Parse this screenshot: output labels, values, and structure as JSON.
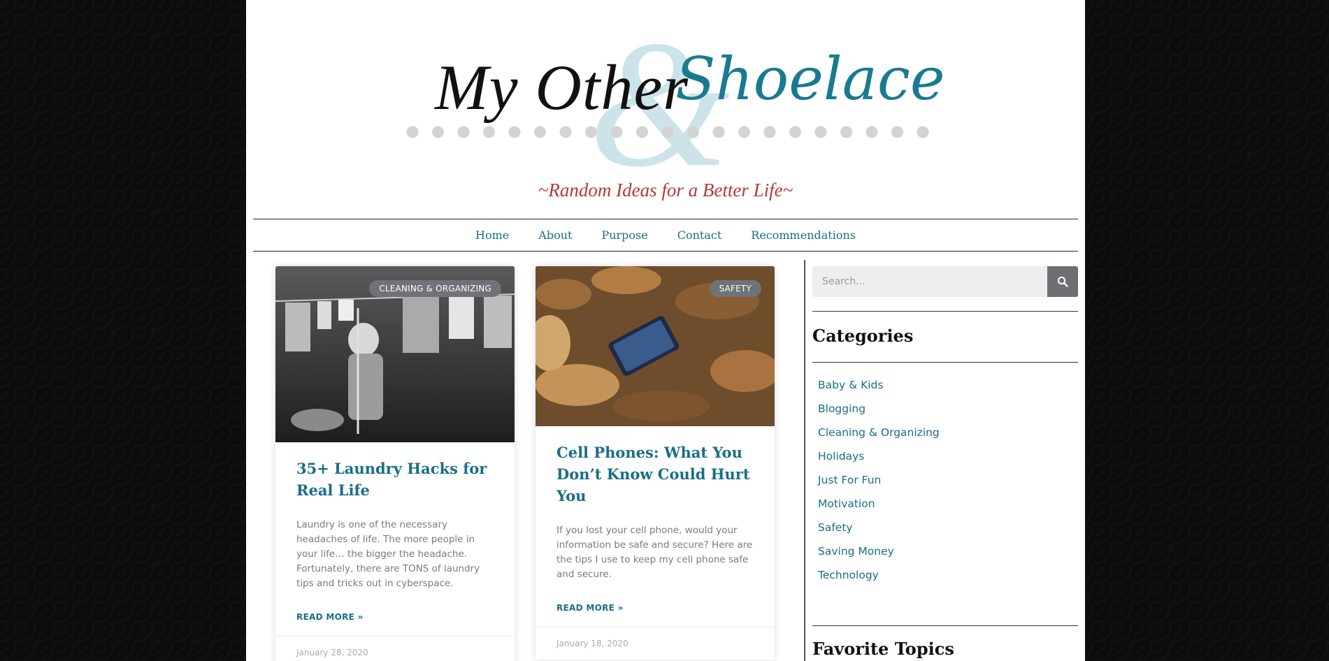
{
  "site": {
    "logo_text_1": "My Other",
    "logo_text_2": "Shoelace",
    "tagline": "~Random Ideas for a Better Life~"
  },
  "nav": {
    "items": [
      {
        "label": "Home"
      },
      {
        "label": "About"
      },
      {
        "label": "Purpose"
      },
      {
        "label": "Contact"
      },
      {
        "label": "Recommendations"
      }
    ]
  },
  "posts": [
    {
      "category": "CLEANING & ORGANIZING",
      "title": "35+ Laundry Hacks for Real Life",
      "excerpt": "Laundry is one of the necessary headaches of life. The more people in your life… the bigger the headache. Fortunately, there are TONS of laundry tips and tricks out in cyberspace.",
      "read_more": "READ MORE »",
      "date": "January 28, 2020"
    },
    {
      "category": "SAFETY",
      "title": "Cell Phones: What You Don’t Know Could Hurt You",
      "excerpt": "If you lost your cell phone, would your information be safe and secure? Here are the tips I use to keep my cell phone safe and secure.",
      "read_more": "READ MORE »",
      "date": "January 18, 2020"
    }
  ],
  "sidebar": {
    "search_placeholder": "Search...",
    "search_icon": "search-icon",
    "categories_heading": "Categories",
    "categories": [
      "Baby & Kids",
      "Blogging",
      "Cleaning & Organizing",
      "Holidays",
      "Just For Fun",
      "Motivation",
      "Safety",
      "Saving Money",
      "Technology"
    ],
    "favorite_heading": "Favorite Topics"
  },
  "colors": {
    "accent": "#1a6e86",
    "tagline": "#b23a34",
    "badge": "#6f7377"
  }
}
